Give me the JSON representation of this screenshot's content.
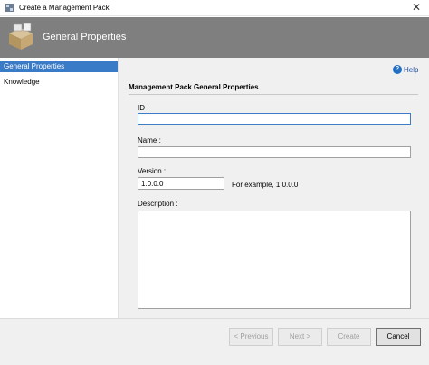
{
  "window": {
    "title": "Create a Management Pack",
    "close_glyph": "✕"
  },
  "banner": {
    "title": "General Properties",
    "icon": "package-box-icon"
  },
  "sidebar": {
    "items": [
      {
        "label": "General Properties",
        "selected": true
      },
      {
        "label": "Knowledge",
        "selected": false
      }
    ]
  },
  "help": {
    "icon_glyph": "?",
    "label": "Help"
  },
  "form": {
    "section_title": "Management Pack General Properties",
    "id_label": "ID :",
    "id_value": "",
    "name_label": "Name :",
    "name_value": "",
    "version_label": "Version :",
    "version_value": "1.0.0.0",
    "version_hint": "For example, 1.0.0.0",
    "description_label": "Description :",
    "description_value": ""
  },
  "footer": {
    "previous_label": "< Previous",
    "next_label": "Next >",
    "create_label": "Create",
    "cancel_label": "Cancel"
  },
  "colors": {
    "selection": "#3a7bc8",
    "banner": "#7f7f7f",
    "focus_border": "#3d7cc9"
  }
}
